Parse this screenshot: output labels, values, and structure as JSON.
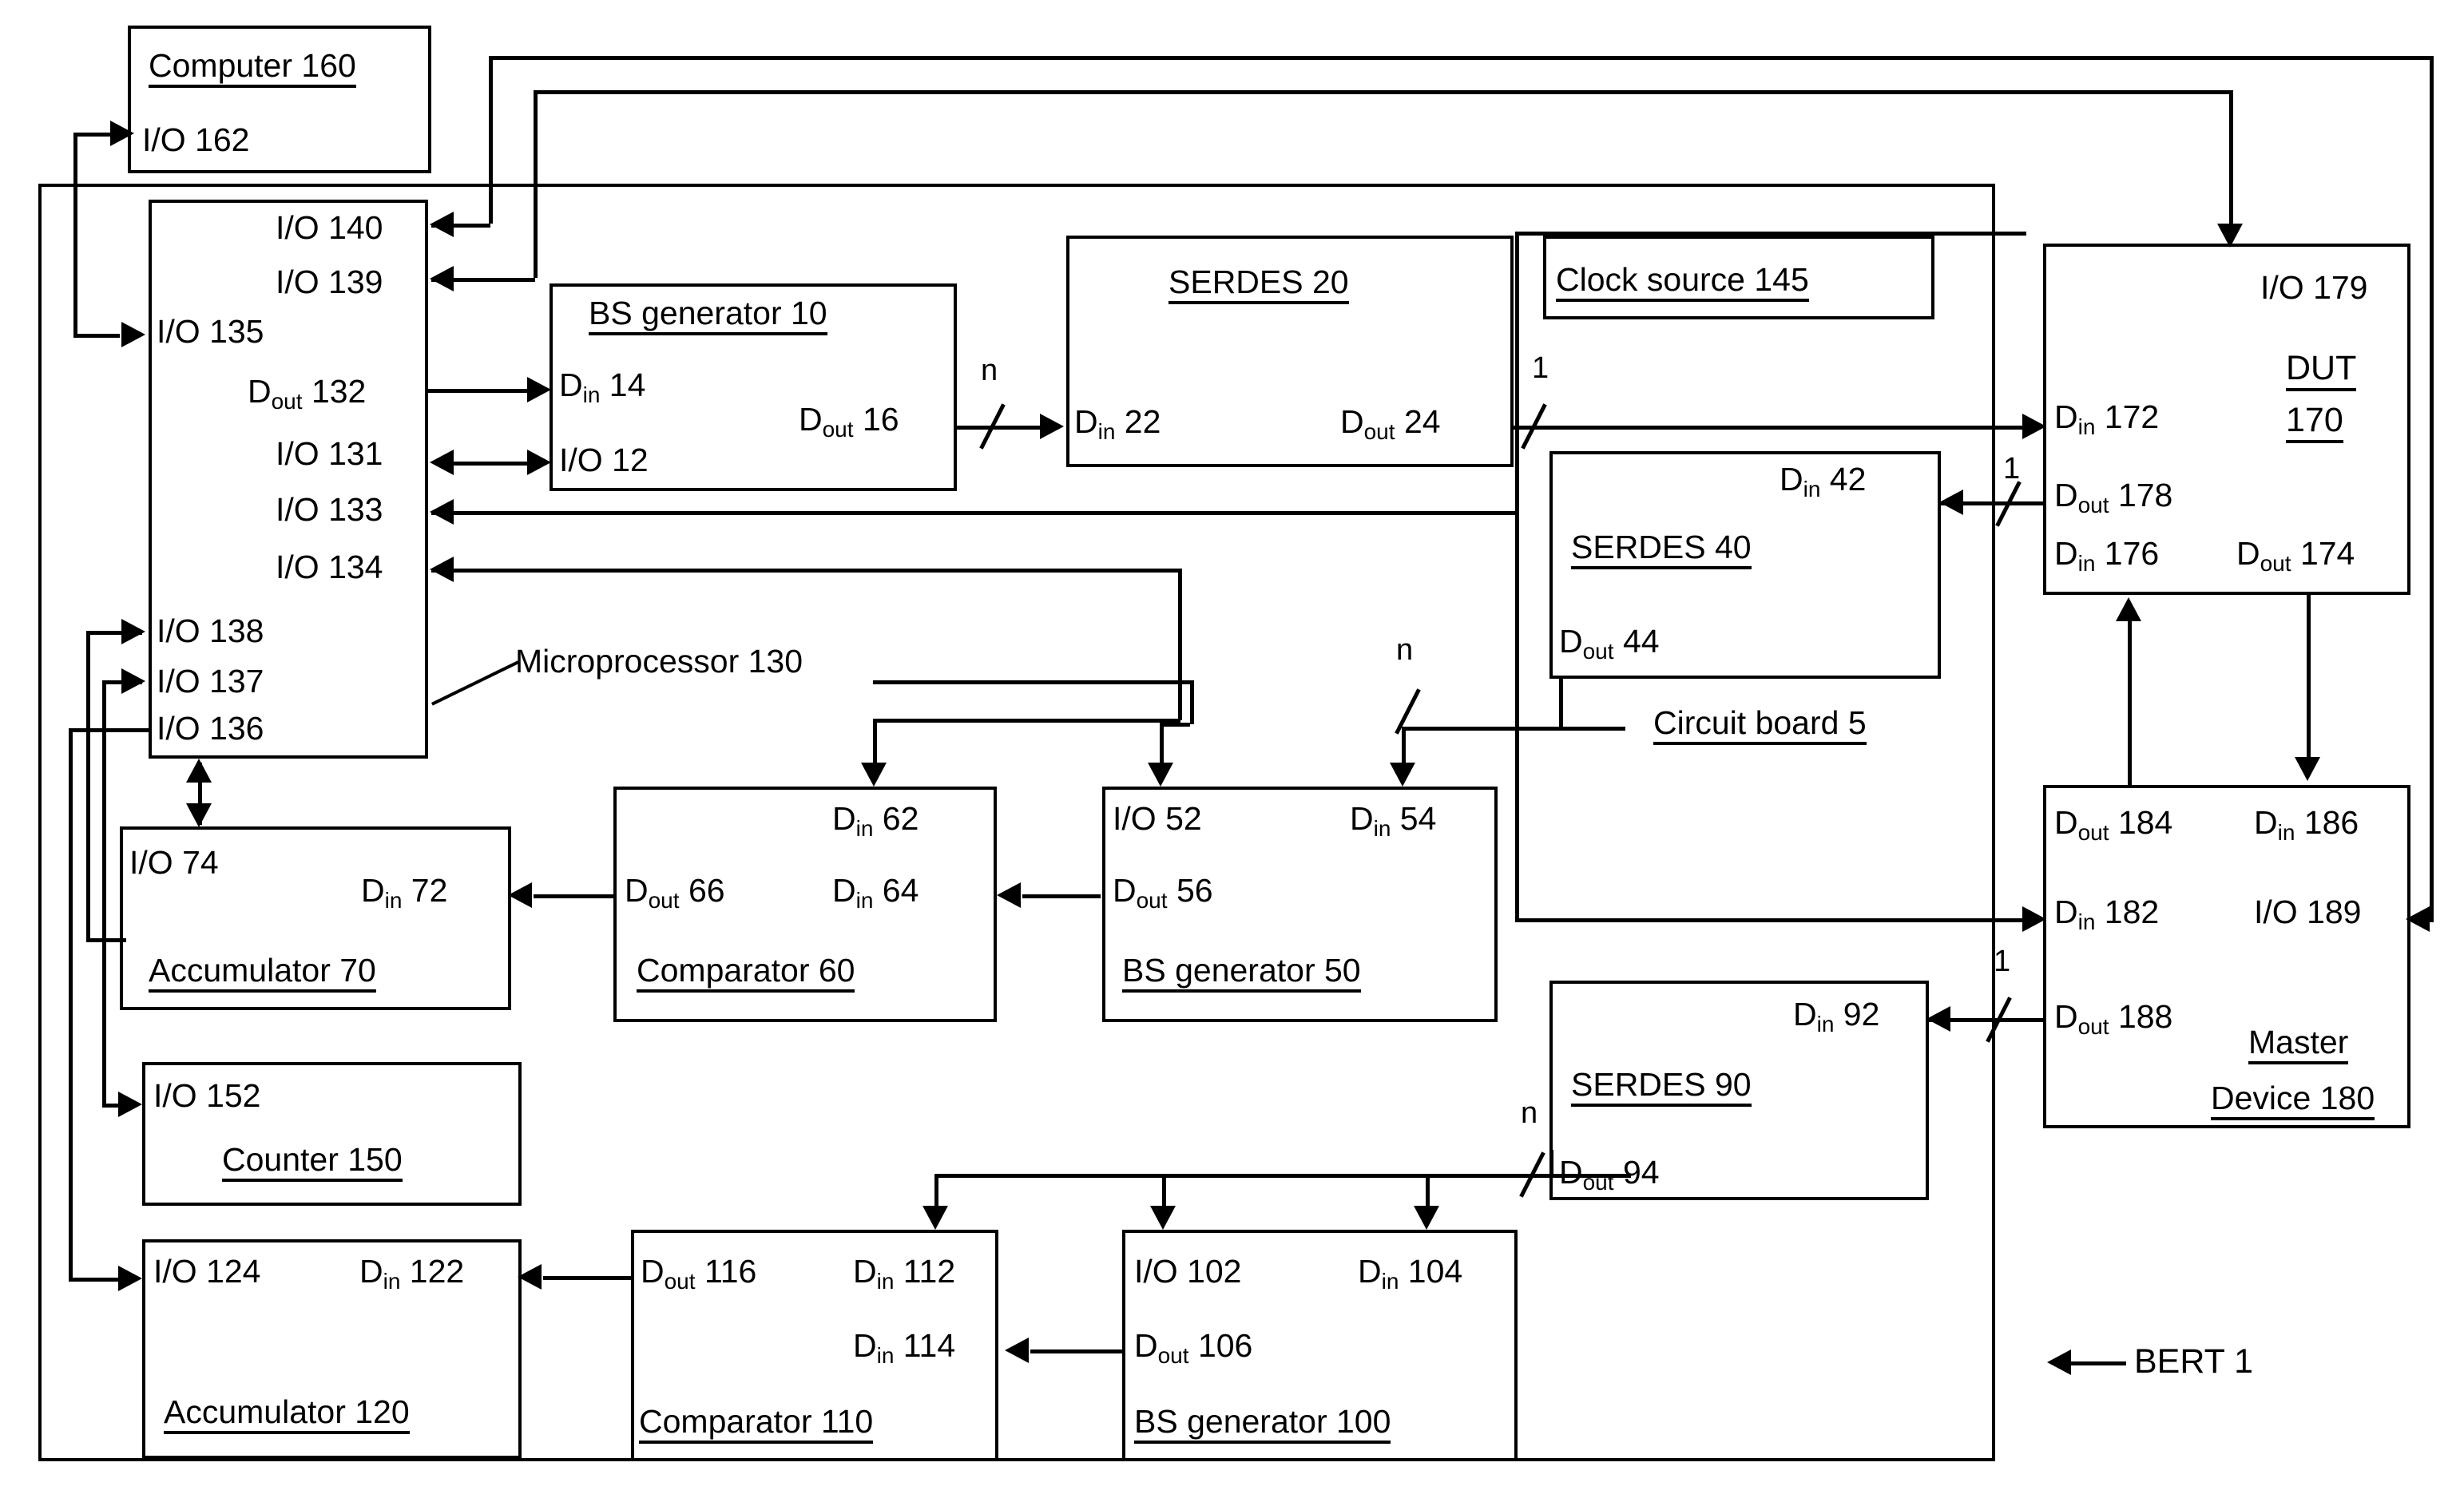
{
  "figure": {
    "name": "BERT block diagram",
    "system_label": "BERT 1",
    "circuit_board_label": "Circuit board 5",
    "microprocessor_leader_label": "Microprocessor 130",
    "line_color": "#000000",
    "background_color": "#ffffff"
  },
  "blocks": {
    "computer": {
      "title": "Computer 160",
      "ports": {
        "io162": "I/O 162"
      }
    },
    "microprocessor": {
      "title": "Microprocessor 130",
      "ports": {
        "io140": "I/O 140",
        "io139": "I/O 139",
        "io135": "I/O 135",
        "dout132_d": "D",
        "dout132_sub": "out",
        "dout132_n": " 132",
        "io131": "I/O 131",
        "io133": "I/O 133",
        "io134": "I/O 134",
        "io138": "I/O 138",
        "io137": "I/O 137",
        "io136": "I/O 136"
      }
    },
    "bs_generator_10": {
      "title": "BS generator 10",
      "ports": {
        "din14_d": "D",
        "din14_sub": "in",
        "din14_n": " 14",
        "io12": "I/O 12",
        "dout16_d": "D",
        "dout16_sub": "out",
        "dout16_n": " 16"
      }
    },
    "serdes_20": {
      "title": "SERDES 20",
      "ports": {
        "din22_d": "D",
        "din22_sub": "in",
        "din22_n": " 22",
        "dout24_d": "D",
        "dout24_sub": "out",
        "dout24_n": " 24"
      }
    },
    "clock_source": {
      "title": "Clock source 145"
    },
    "dut": {
      "title_line1": "DUT",
      "title_line2": "170",
      "ports": {
        "io179": "I/O 179",
        "din172_d": "D",
        "din172_sub": "in",
        "din172_n": " 172",
        "dout178_d": "D",
        "dout178_sub": "out",
        "dout178_n": " 178",
        "din176_d": "D",
        "din176_sub": "in",
        "din176_n": " 176",
        "dout174_d": "D",
        "dout174_sub": "out",
        "dout174_n": " 174"
      }
    },
    "serdes_40": {
      "title": "SERDES 40",
      "ports": {
        "din42_d": "D",
        "din42_sub": "in",
        "din42_n": " 42",
        "dout44_d": "D",
        "dout44_sub": "out",
        "dout44_n": " 44"
      }
    },
    "accumulator_70": {
      "title": "Accumulator 70",
      "ports": {
        "io74": "I/O 74",
        "din72_d": "D",
        "din72_sub": "in",
        "din72_n": " 72"
      }
    },
    "comparator_60": {
      "title": "Comparator 60",
      "ports": {
        "dout66_d": "D",
        "dout66_sub": "out",
        "dout66_n": " 66",
        "din62_d": "D",
        "din62_sub": "in",
        "din62_n": " 62",
        "din64_d": "D",
        "din64_sub": "in",
        "din64_n": " 64"
      }
    },
    "bs_generator_50": {
      "title": "BS generator 50",
      "ports": {
        "io52": "I/O 52",
        "din54_d": "D",
        "din54_sub": "in",
        "din54_n": " 54",
        "dout56_d": "D",
        "dout56_sub": "out",
        "dout56_n": " 56"
      }
    },
    "master_device": {
      "title_line1": "Master",
      "title_line2": "Device 180",
      "ports": {
        "dout184_d": "D",
        "dout184_sub": "out",
        "dout184_n": " 184",
        "din186_d": "D",
        "din186_sub": "in",
        "din186_n": " 186",
        "din182_d": "D",
        "din182_sub": "in",
        "din182_n": " 182",
        "io189": "I/O 189",
        "dout188_d": "D",
        "dout188_sub": "out",
        "dout188_n": " 188"
      }
    },
    "counter_150": {
      "title": "Counter 150",
      "ports": {
        "io152": "I/O 152"
      }
    },
    "serdes_90": {
      "title": "SERDES 90",
      "ports": {
        "din92_d": "D",
        "din92_sub": "in",
        "din92_n": " 92",
        "dout94_d": "D",
        "dout94_sub": "out",
        "dout94_n": " 94"
      }
    },
    "accumulator_120": {
      "title": "Accumulator 120",
      "ports": {
        "io124": "I/O 124",
        "din122_d": "D",
        "din122_sub": "in",
        "din122_n": " 122"
      }
    },
    "comparator_110": {
      "title": "Comparator 110",
      "ports": {
        "dout116_d": "D",
        "dout116_sub": "out",
        "dout116_n": " 116",
        "din112_d": "D",
        "din112_sub": "in",
        "din112_n": " 112",
        "din114_d": "D",
        "din114_sub": "in",
        "din114_n": " 114"
      }
    },
    "bs_generator_100": {
      "title": "BS generator 100",
      "ports": {
        "io102": "I/O 102",
        "din104_d": "D",
        "din104_sub": "in",
        "din104_n": " 104",
        "dout106_d": "D",
        "dout106_sub": "out",
        "dout106_n": " 106"
      }
    }
  },
  "bus_width_labels": {
    "n_bs10_to_serdes20": "n",
    "one_serdes20_to_dut": "1",
    "one_dut_dout178": "1",
    "n_serdes40_to_bs50": "n",
    "one_master_dout188": "1",
    "n_serdes90_to_bs100": "n"
  }
}
